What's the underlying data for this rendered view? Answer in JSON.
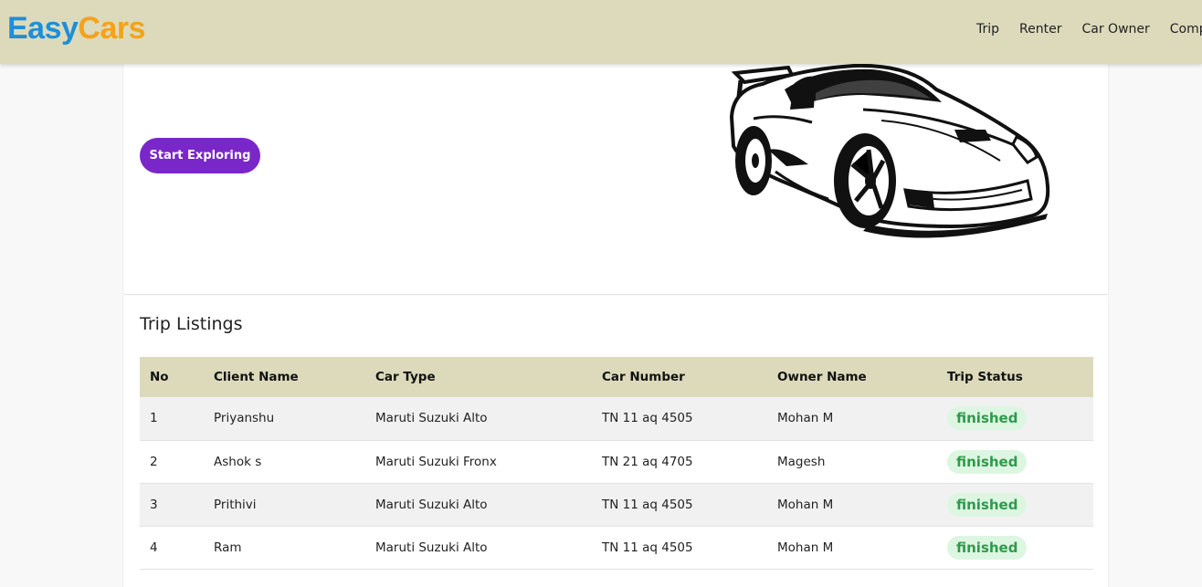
{
  "brand": {
    "part1": "Easy",
    "part2": "Cars",
    "color1": "#1f8ed8",
    "color2": "#f4a21a"
  },
  "nav": {
    "items": [
      "Trip",
      "Renter",
      "Car Owner",
      "Complaints"
    ]
  },
  "hero": {
    "cta_label": "Start Exploring",
    "accent": "#7a27c9",
    "image": "sports-car-illustration"
  },
  "listings": {
    "title": "Trip Listings",
    "headers": [
      "No",
      "Client Name",
      "Car Type",
      "Car Number",
      "Owner Name",
      "Trip Status"
    ],
    "rows": [
      {
        "no": "1",
        "client": "Priyanshu",
        "car_type": "Maruti Suzuki Alto",
        "car_number": "TN 11 aq 4505",
        "owner": "Mohan M",
        "status": "finished"
      },
      {
        "no": "2",
        "client": "Ashok s",
        "car_type": "Maruti Suzuki Fronx",
        "car_number": "TN 21 aq 4705",
        "owner": "Magesh",
        "status": "finished"
      },
      {
        "no": "3",
        "client": "Prithivi",
        "car_type": "Maruti Suzuki Alto",
        "car_number": "TN 11 aq 4505",
        "owner": "Mohan M",
        "status": "finished"
      },
      {
        "no": "4",
        "client": "Ram",
        "car_type": "Maruti Suzuki Alto",
        "car_number": "TN 11 aq 4505",
        "owner": "Mohan M",
        "status": "finished"
      }
    ],
    "header_color": "#dcdabb",
    "status_color": "#2e9a4c"
  }
}
